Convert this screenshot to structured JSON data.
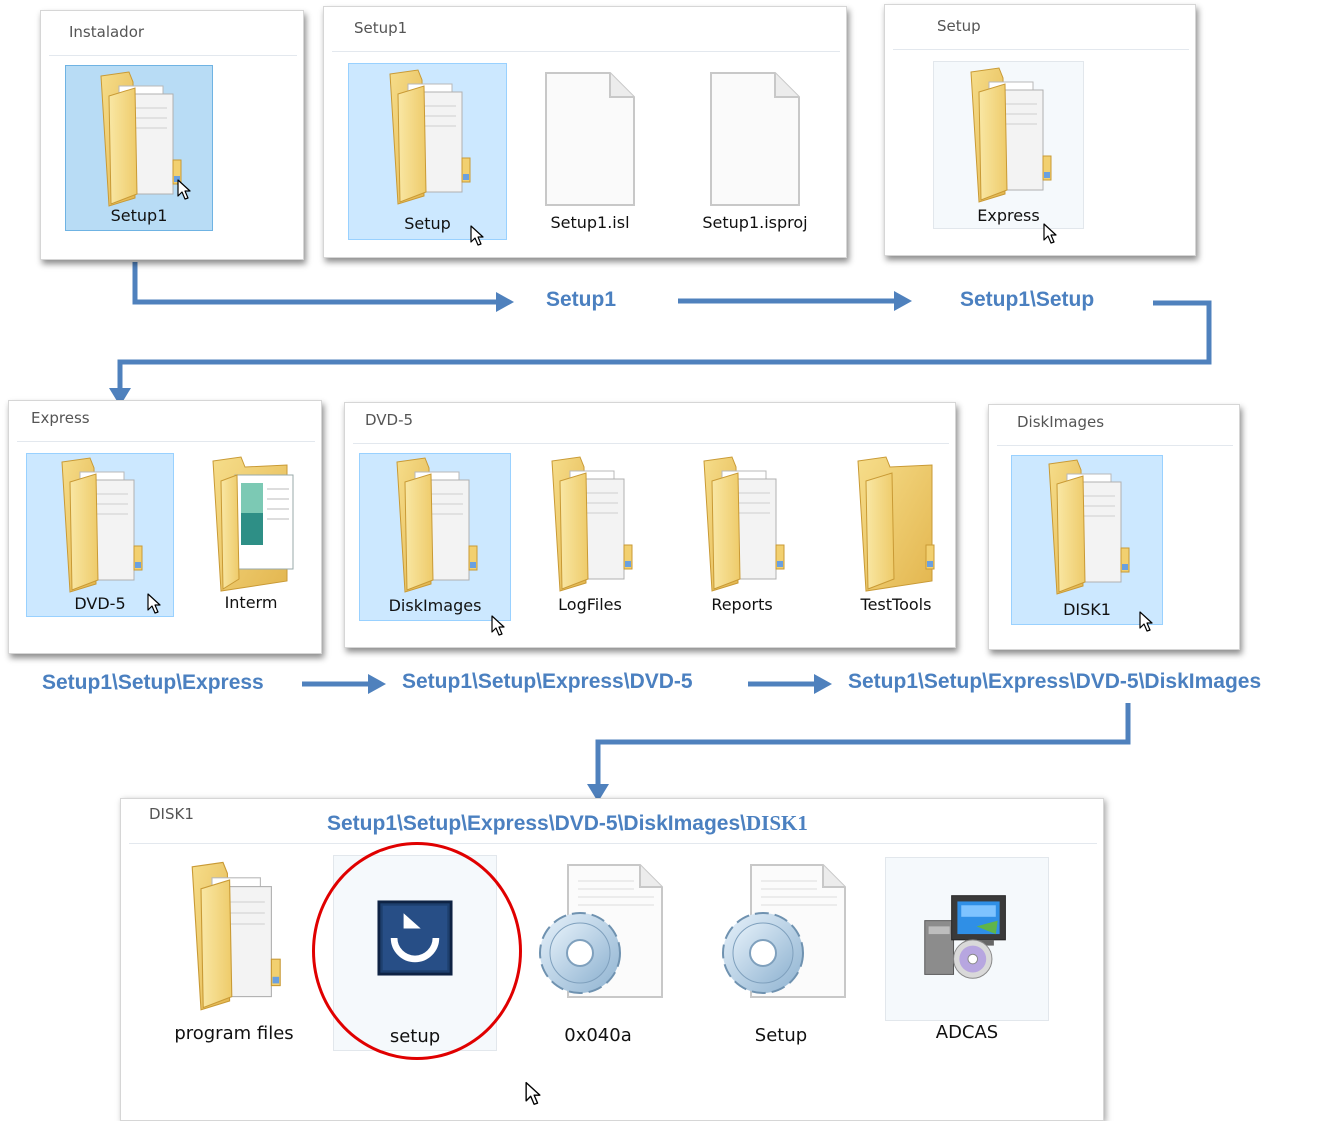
{
  "colors": {
    "arrow": "#4f81bd",
    "path_text": "#4b80c0",
    "highlight_circle": "#e00000",
    "selection": "#cce8ff"
  },
  "panels": {
    "instalador": {
      "title": "Instalador",
      "items": [
        {
          "label": "Setup1",
          "icon": "folder-documents-icon"
        }
      ]
    },
    "setup1": {
      "title": "Setup1",
      "items": [
        {
          "label": "Setup",
          "icon": "folder-documents-icon"
        },
        {
          "label": "Setup1.isl",
          "icon": "blank-file-icon"
        },
        {
          "label": "Setup1.isproj",
          "icon": "blank-file-icon"
        }
      ]
    },
    "setup": {
      "title": "Setup",
      "items": [
        {
          "label": "Express",
          "icon": "folder-documents-icon"
        }
      ]
    },
    "express": {
      "title": "Express",
      "items": [
        {
          "label": "DVD-5",
          "icon": "folder-documents-icon"
        },
        {
          "label": "Interm",
          "icon": "folder-preview-icon"
        }
      ]
    },
    "dvd5": {
      "title": "DVD-5",
      "items": [
        {
          "label": "DiskImages",
          "icon": "folder-documents-icon"
        },
        {
          "label": "LogFiles",
          "icon": "folder-documents-icon"
        },
        {
          "label": "Reports",
          "icon": "folder-documents-icon"
        },
        {
          "label": "TestTools",
          "icon": "folder-icon"
        }
      ]
    },
    "diskimages": {
      "title": "DiskImages",
      "items": [
        {
          "label": "DISK1",
          "icon": "folder-documents-icon"
        }
      ]
    },
    "disk1": {
      "title": "DISK1",
      "items": [
        {
          "label": "program files",
          "icon": "folder-documents-icon"
        },
        {
          "label": "setup",
          "icon": "installer-app-icon"
        },
        {
          "label": "0x040a",
          "icon": "settings-file-icon"
        },
        {
          "label": "Setup",
          "icon": "settings-file-icon"
        },
        {
          "label": "ADCAS",
          "icon": "installer-package-icon"
        }
      ]
    }
  },
  "paths": {
    "p1": "Setup1",
    "p2": "Setup1\\Setup",
    "p3": "Setup1\\Setup\\Express",
    "p4": "Setup1\\Setup\\Express\\DVD-5",
    "p5": "Setup1\\Setup\\Express\\DVD-5\\DiskImages",
    "p6_main": "Setup1\\Setup\\Express\\DVD-5\\DiskImages\\",
    "p6_tail": "DISK1"
  }
}
